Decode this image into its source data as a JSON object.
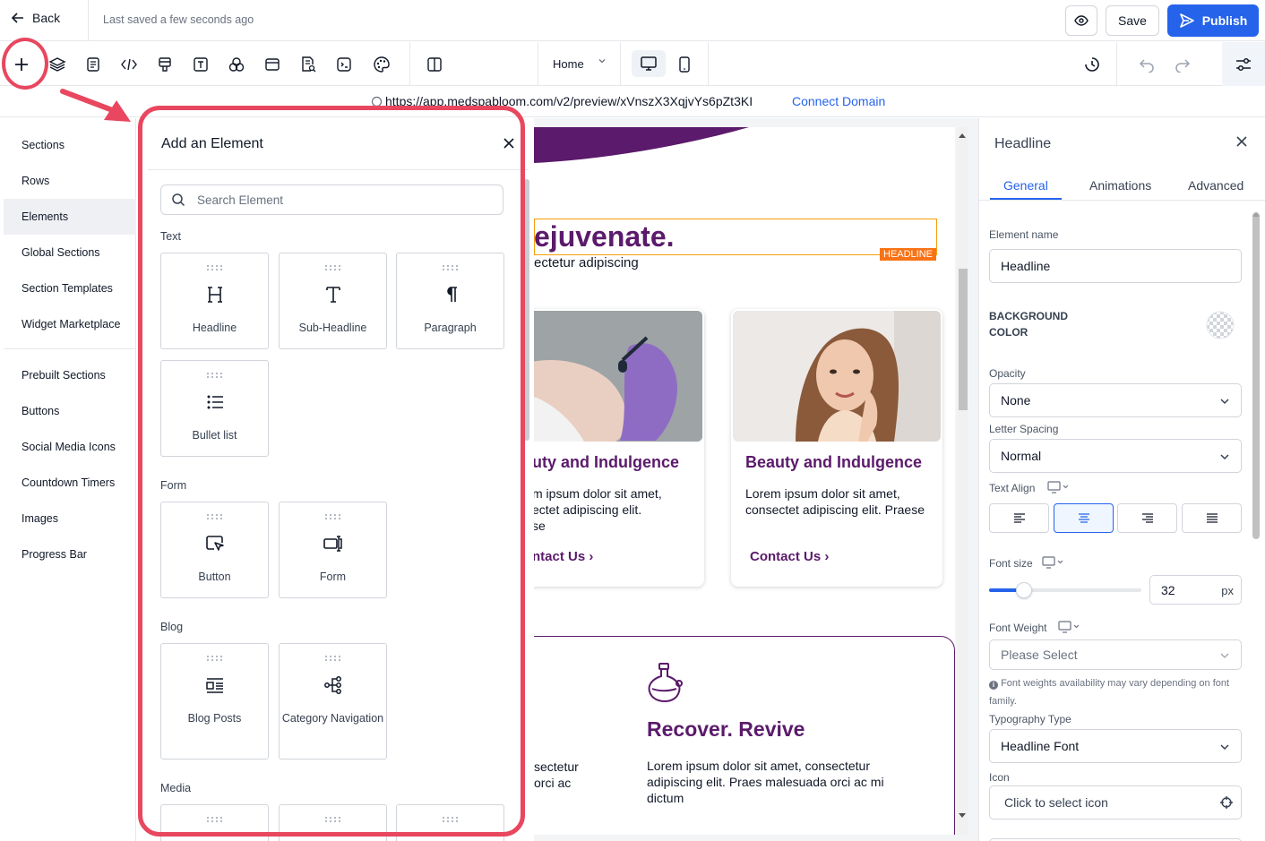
{
  "topbar": {
    "back_label": "Back",
    "saved_status": "Last saved a few seconds ago",
    "save_label": "Save",
    "publish_label": "Publish"
  },
  "toolbar": {
    "page_select": "Home",
    "tools": [
      "add-icon",
      "layers-icon",
      "page-icon",
      "code-icon",
      "popup-icon",
      "text-icon",
      "shapes-icon",
      "browser-icon",
      "search-doc-icon",
      "terminal-icon",
      "palette-icon",
      "split-view-icon"
    ]
  },
  "urlbar": {
    "url": "https://app.medspabloom.com/v2/preview/xVnszX3XqjvYs6pZt3KI",
    "connect_label": "Connect Domain"
  },
  "leftnav": {
    "items": [
      "Sections",
      "Rows",
      "Elements",
      "Global Sections",
      "Section Templates",
      "Widget Marketplace"
    ],
    "items2": [
      "Prebuilt Sections",
      "Buttons",
      "Social Media Icons",
      "Countdown Timers",
      "Images",
      "Progress Bar"
    ],
    "active": "Elements"
  },
  "panel": {
    "title": "Add an Element",
    "search_placeholder": "Search Element",
    "groups": {
      "text": {
        "label": "Text",
        "items": [
          "Headline",
          "Sub-Headline",
          "Paragraph",
          "Bullet list"
        ]
      },
      "form": {
        "label": "Form",
        "items": [
          "Button",
          "Form"
        ]
      },
      "blog": {
        "label": "Blog",
        "items": [
          "Blog Posts",
          "Category Navigation"
        ]
      },
      "media": {
        "label": "Media"
      }
    }
  },
  "canvas": {
    "headline": "ejuvenate.",
    "headline_tag": "HEADLINE",
    "subheadline": "ectetur adipiscing",
    "card1": {
      "title": "uty and Indulgence",
      "body_line1": "m ipsum dolor sit amet,",
      "body_line2": "ectet adipiscing elit.",
      "body_line3": "se",
      "link": "ntact Us"
    },
    "card2": {
      "title": "Beauty and Indulgence",
      "body": "Lorem ipsum dolor sit amet, consectet adipiscing elit. Praese",
      "link": "Contact Us"
    },
    "recover": {
      "title": "Recover. Revive",
      "body": "Lorem ipsum dolor sit amet, consectetur adipiscing elit. Praes malesuada orci ac mi dictum",
      "left_line1": "sectetur",
      "left_line2": "orci ac"
    }
  },
  "rpanel": {
    "title": "Headline",
    "tabs": [
      "General",
      "Animations",
      "Advanced"
    ],
    "active_tab": "General",
    "element_name_label": "Element name",
    "element_name_value": "Headline",
    "bg_color_label_1": "BACKGROUND",
    "bg_color_label_2": "COLOR",
    "opacity_label": "Opacity",
    "opacity_value": "None",
    "letter_spacing_label": "Letter Spacing",
    "letter_spacing_value": "Normal",
    "text_align_label": "Text Align",
    "text_align_value": "center",
    "font_size_label": "Font size",
    "font_size_value": "32",
    "font_size_unit": "px",
    "font_size_slider_fraction": 0.23,
    "font_weight_label": "Font Weight",
    "font_weight_placeholder": "Please Select",
    "font_weight_note": "Font weights availability may vary depending on font family.",
    "typography_label": "Typography Type",
    "typography_value": "Headline Font",
    "icon_label": "Icon",
    "icon_placeholder": "Click to select icon"
  },
  "colors": {
    "accent": "#2563eb",
    "brand_purple": "#5b1a6b",
    "annotation_red": "#e8475f",
    "selection_orange": "#f97316"
  }
}
